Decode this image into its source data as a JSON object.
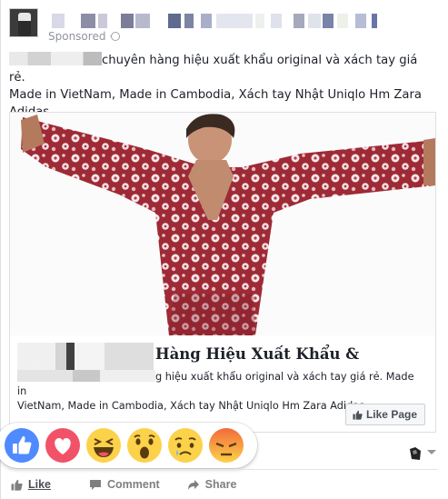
{
  "post": {
    "sponsored_label": "Sponsored ·",
    "text_line1": "chuyên hàng hiệu xuất khẩu original và xách tay giá rẻ.",
    "text_line2": "Made in VietNam, Made in Cambodia, Xách tay Nhật Uniqlo Hm Zara",
    "text_line3": "Adidas"
  },
  "link_preview": {
    "title": "Hàng Hiệu Xuất Khẩu &",
    "description_line1": "g hiệu xuất khẩu original và xách tay giá rẻ. Made in",
    "description_line2": "VietNam, Made in Cambodia, Xách tay Nhật Uniqlo Hm Zara Adidas",
    "like_page_label": "Like Page"
  },
  "reactions": [
    {
      "name": "like",
      "icon": "like-reaction-icon",
      "color": "#5890ff"
    },
    {
      "name": "love",
      "icon": "love-reaction-icon",
      "color": "#f25268"
    },
    {
      "name": "haha",
      "icon": "haha-reaction-icon",
      "color": "#fcd24a"
    },
    {
      "name": "wow",
      "icon": "wow-reaction-icon",
      "color": "#fcd24a"
    },
    {
      "name": "sad",
      "icon": "sad-reaction-icon",
      "color": "#fcd24a"
    },
    {
      "name": "angry",
      "icon": "angry-reaction-icon",
      "color": "#f07a3a"
    }
  ],
  "actions": {
    "like_label": "Like",
    "comment_label": "Comment",
    "share_label": "Share"
  },
  "colors": {
    "accent": "#4267b2",
    "muted": "#90949c",
    "text": "#1d2129"
  }
}
